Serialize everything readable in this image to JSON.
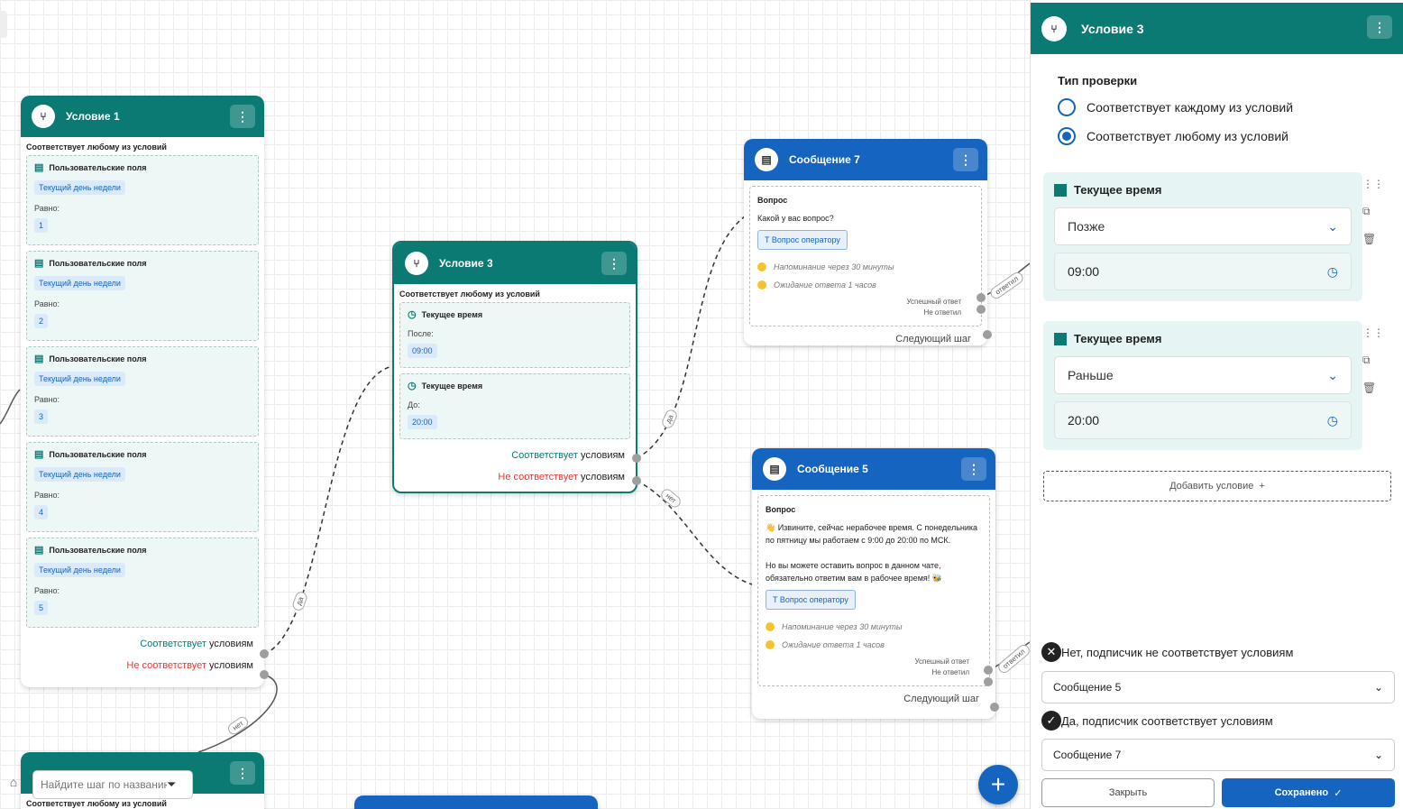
{
  "condition1": {
    "title": "Условие 1",
    "type_text": "Соответствует любому из условий",
    "items": [
      {
        "title": "Пользовательские поля",
        "field": "Текущий день недели",
        "op": "Равно:",
        "value": "1"
      },
      {
        "title": "Пользовательские поля",
        "field": "Текущий день недели",
        "op": "Равно:",
        "value": "2"
      },
      {
        "title": "Пользовательские поля",
        "field": "Текущий день недели",
        "op": "Равно:",
        "value": "3"
      },
      {
        "title": "Пользовательские поля",
        "field": "Текущий день недели",
        "op": "Равно:",
        "value": "4"
      },
      {
        "title": "Пользовательские поля",
        "field": "Текущий день недели",
        "op": "Равно:",
        "value": "5"
      }
    ],
    "out_match_a": "Соответствует",
    "out_match_b": " условиям",
    "out_nomatch_a": "Не соответствует",
    "out_nomatch_b": " условиям"
  },
  "condition3": {
    "title": "Условие 3",
    "type_text": "Соответствует любому из условий",
    "items": [
      {
        "title": "Текущее время",
        "op": "После:",
        "value": "09:00"
      },
      {
        "title": "Текущее время",
        "op": "До:",
        "value": "20:00"
      }
    ],
    "out_match_a": "Соответствует",
    "out_match_b": " условиям",
    "out_nomatch_a": "Не соответствует",
    "out_nomatch_b": " условиям"
  },
  "message7": {
    "title": "Сообщение 7",
    "label": "Вопрос",
    "text": "Какой у вас вопрос?",
    "button": "Вопрос оператору",
    "reminder": "Напоминание через 30 минуты",
    "wait": "Ожидание ответа 1 часов",
    "success": "Успешный ответ",
    "no_answer": "Не ответил",
    "next": "Следующий шаг"
  },
  "message5": {
    "title": "Сообщение 5",
    "label": "Вопрос",
    "text1": "👋 Извините, сейчас нерабочее время. С понедельника по пятницу мы работаем с 9:00 до 20:00 по МСК.",
    "text2": "Но вы можете оставить вопрос в данном чате, обязательно ответим вам в рабочее время! 🐝",
    "button": "Вопрос оператору",
    "reminder": "Напоминание через 30 минуты",
    "wait": "Ожидание ответа 1 часов",
    "success": "Успешный ответ",
    "no_answer": "Не ответил",
    "next": "Следующий шаг"
  },
  "bottom_node": {
    "type_text": "Соответствует любому из условий"
  },
  "edge_labels": {
    "yes": "да",
    "no": "нет",
    "answered": "ответил"
  },
  "search": {
    "placeholder": "Найдите шаг по названию"
  },
  "fab_label": "+",
  "panel": {
    "title": "Условие 3",
    "check_type_label": "Тип проверки",
    "options": [
      "Соответствует каждому из условий",
      "Соответствует любому из условий"
    ],
    "selected_option": 1,
    "conditions": [
      {
        "title": "Текущее время",
        "operator": "Позже",
        "time": "09:00"
      },
      {
        "title": "Текущее время",
        "operator": "Раньше",
        "time": "20:00"
      }
    ],
    "add_condition": "Добавить условие",
    "no_label": "Нет, подписчик не соответствует условиям",
    "no_target": "Сообщение 5",
    "yes_label": "Да, подписчик соответствует условиям",
    "yes_target": "Сообщение 7",
    "close_button": "Закрыть",
    "save_button": "Сохранено"
  },
  "colors": {
    "teal": "#0a7a73",
    "blue": "#1565c0",
    "red": "#e53935"
  }
}
